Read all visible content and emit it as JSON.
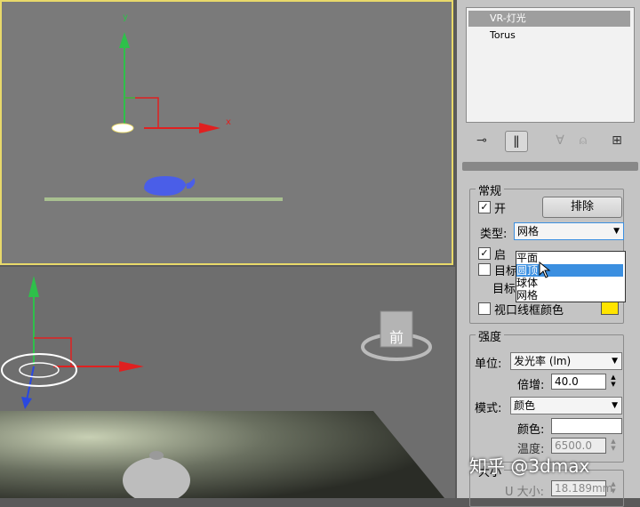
{
  "viewport_top": {
    "axis_x": "x",
    "axis_y": "y"
  },
  "viewport_persp": {
    "viewcube_label": "前"
  },
  "scene_list": {
    "items": [
      {
        "label": "VR-灯光"
      },
      {
        "label": "Torus"
      }
    ]
  },
  "general": {
    "title": "常规",
    "on_label": "开",
    "on_checked": true,
    "exclude_button": "排除",
    "type_label": "类型:",
    "type_value": "网格",
    "type_options": [
      "平面",
      "圆顶",
      "球体",
      "网格"
    ],
    "highlighted_option_index": 1,
    "enable_label": "启",
    "enable_checked": true,
    "target_label": "目标",
    "target_checked": false,
    "target_dist_label": "目标",
    "viewport_wire_label": "视口线框颜色",
    "viewport_wire_checked": false,
    "wire_color": "#ffe400"
  },
  "intensity": {
    "title": "强度",
    "unit_label": "单位:",
    "unit_value": "发光率 (lm)",
    "multiplier_label": "倍增:",
    "multiplier_value": "40.0",
    "mode_label": "模式:",
    "mode_value": "颜色",
    "color_label": "颜色:",
    "color_value": "#ffffff",
    "temp_label": "温度:",
    "temp_value": "6500.0"
  },
  "size": {
    "title": "大小",
    "u_size_label": "U 大小:",
    "u_size_value": "18.189mm"
  },
  "watermark": "知乎 @3dmax",
  "colors": {
    "accent_yellow": "#e8d96a",
    "highlight_blue": "#3b8fe0"
  }
}
